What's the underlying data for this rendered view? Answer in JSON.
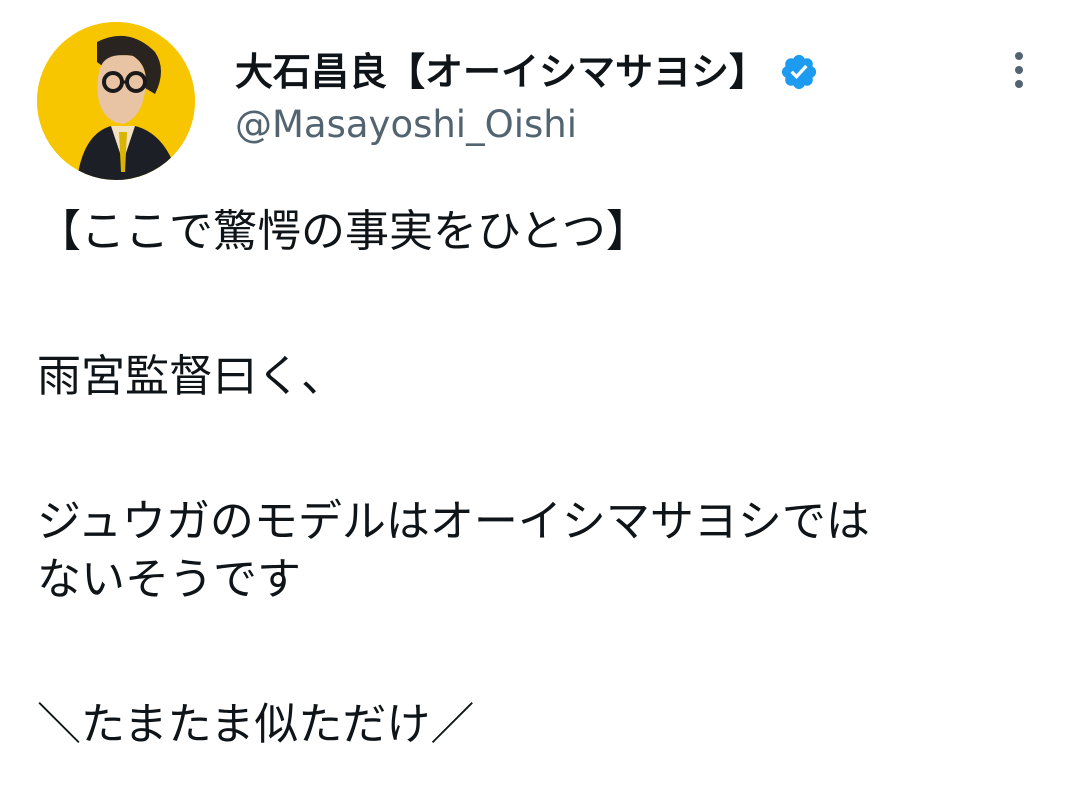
{
  "author": {
    "display_name": "大石昌良【オーイシマサヨシ】",
    "handle": "@Masayoshi_Oishi",
    "verified": true,
    "avatar_bg": "#f7c600"
  },
  "tweet": {
    "lines": [
      "【ここで驚愕の事実をひとつ】",
      "雨宮監督曰く、",
      "ジュウガのモデルはオーイシマサヨシでは",
      "ないそうです",
      "＼たまたま似ただけ／"
    ]
  },
  "colors": {
    "text": "#0f1419",
    "secondary": "#536471",
    "verified_badge": "#1d9bf0"
  },
  "icons": {
    "verified": "verified-badge-icon",
    "more": "more-vertical-icon"
  }
}
